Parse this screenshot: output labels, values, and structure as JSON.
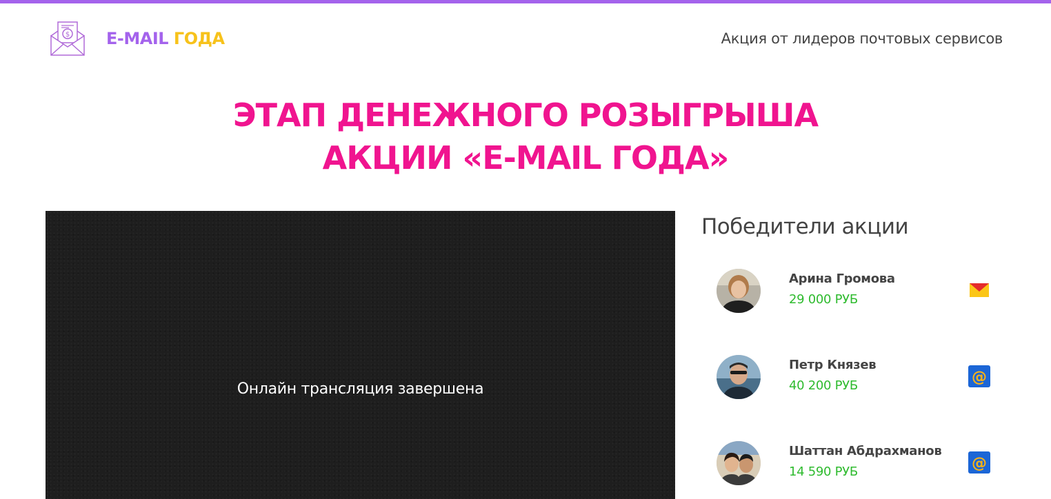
{
  "header": {
    "logo_email": "E-MAIL",
    "logo_year": "ГОДА",
    "tagline": "Акция от лидеров почтовых сервисов"
  },
  "headline": {
    "line1": "ЭТАП ДЕНЕЖНОГО РОЗЫГРЫША",
    "line2": "АКЦИИ «E-MAIL ГОДА»"
  },
  "video": {
    "status": "Онлайн трансляция завершена"
  },
  "winners": {
    "title": "Победители акции",
    "items": [
      {
        "name": "Арина Громова",
        "amount": "29 000 РУБ",
        "service_icon": "yandex-mail-icon"
      },
      {
        "name": "Петр Князев",
        "amount": "40 200 РУБ",
        "service_icon": "mail-ru-icon"
      },
      {
        "name": "Шаттан Абдрахманов",
        "amount": "14 590 РУБ",
        "service_icon": "mail-ru-icon"
      }
    ]
  },
  "colors": {
    "top_bar": "#a463ec",
    "logo_email": "#a463ec",
    "logo_year": "#f7c21b",
    "headline": "#f0148f",
    "amount": "#2fbb2f",
    "video_bg": "#1e1e1e"
  }
}
